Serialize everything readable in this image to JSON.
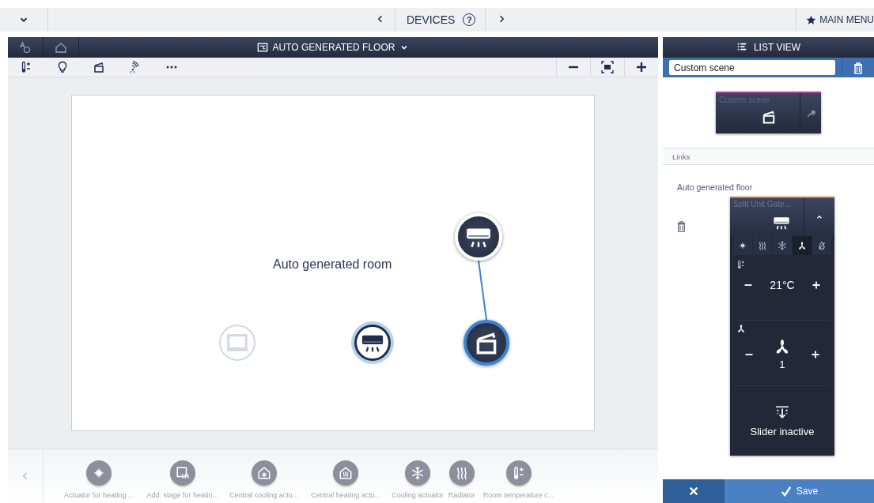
{
  "top_bar": {
    "menu_expanded": false,
    "title": "DEVICES",
    "help": "?",
    "main_menu": "MAIN MENU"
  },
  "floor_panel": {
    "title": "AUTO GENERATED FLOOR",
    "header_tabs": [
      {
        "kind": "auto",
        "selected": false
      },
      {
        "kind": "home",
        "selected": false
      }
    ],
    "tools": [
      {
        "kind": "thermo"
      },
      {
        "kind": "bulb"
      },
      {
        "kind": "scene"
      },
      {
        "kind": "signal"
      },
      {
        "kind": "more"
      }
    ],
    "canvas": {
      "room_label": "Auto generated room",
      "nodes": [
        {
          "kind": "screen",
          "disabled": true,
          "highlighted": false,
          "selected": false,
          "connected": false
        },
        {
          "kind": "ac",
          "disabled": false,
          "highlighted": true,
          "selected": false,
          "connected": false
        },
        {
          "kind": "scene",
          "disabled": false,
          "highlighted": false,
          "selected": true,
          "connected": false
        },
        {
          "kind": "ac",
          "disabled": false,
          "highlighted": false,
          "selected": false,
          "connected": true
        }
      ]
    },
    "palette": [
      {
        "kind": "sun",
        "label": "Actuator for heating ..."
      },
      {
        "kind": "stage",
        "label": "Add. stage for heatin..."
      },
      {
        "kind": "housecool",
        "label": "Central cooling actu..."
      },
      {
        "kind": "househeat",
        "label": "Central heating actu..."
      },
      {
        "kind": "snow",
        "label": "Cooling actuator"
      },
      {
        "kind": "heat",
        "label": "Radiator"
      },
      {
        "kind": "thermo",
        "label": "Room temperature c..."
      }
    ]
  },
  "side_panel": {
    "title": "LIST VIEW",
    "scene_name": "Custom scene",
    "scene_card": {
      "title": "Custom scene"
    },
    "links_header": "Links",
    "link_floor": "Auto generated floor",
    "device": {
      "title": "Split Unit Gate...",
      "expanded": true,
      "modes": [
        {
          "kind": "sun",
          "selected": false
        },
        {
          "kind": "heat",
          "selected": false
        },
        {
          "kind": "snow",
          "selected": false
        },
        {
          "kind": "fan",
          "selected": true
        },
        {
          "kind": "dry",
          "selected": false
        }
      ],
      "temperature": "21°C",
      "fan_speed": "1",
      "slider_status": "Slider inactive"
    },
    "save": "Save"
  }
}
